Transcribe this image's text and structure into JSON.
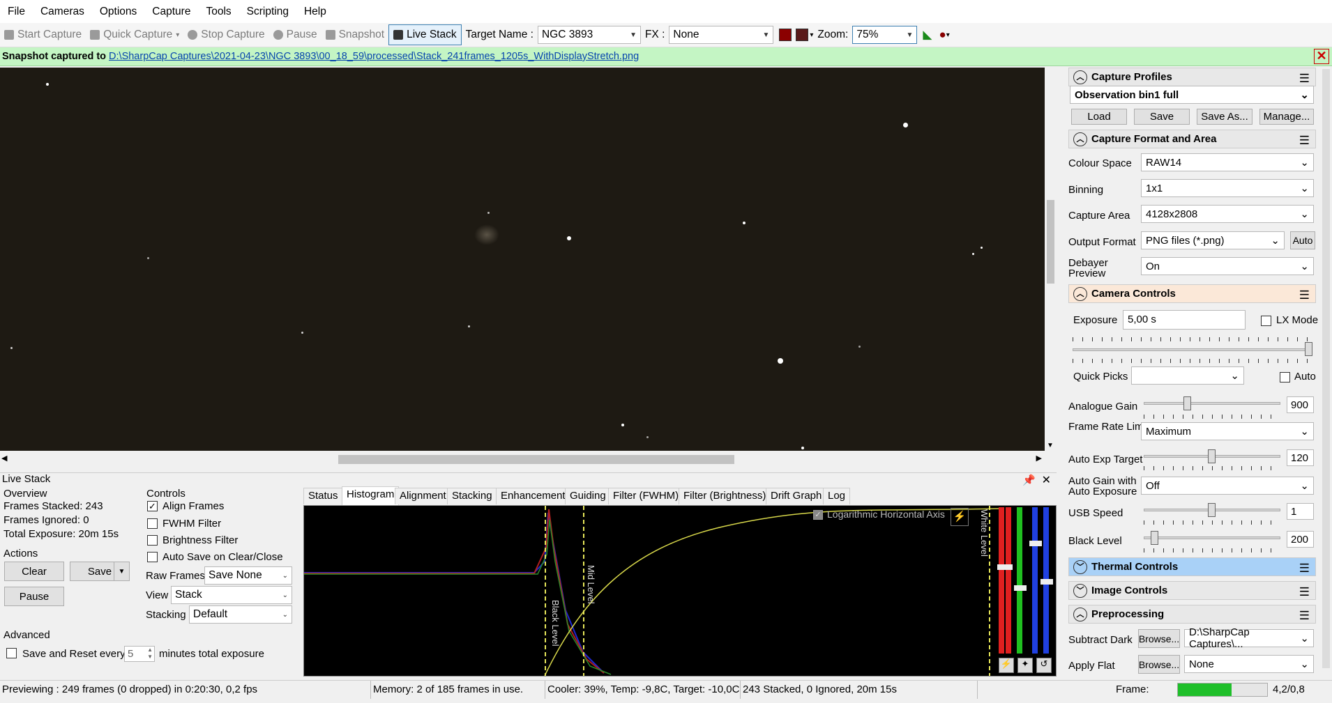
{
  "menu": [
    "File",
    "Cameras",
    "Options",
    "Capture",
    "Tools",
    "Scripting",
    "Help"
  ],
  "toolbar": {
    "start_capture": "Start Capture",
    "quick_capture": "Quick Capture",
    "stop_capture": "Stop Capture",
    "pause": "Pause",
    "snapshot": "Snapshot",
    "live_stack": "Live Stack",
    "target_label": "Target Name :",
    "target_value": "NGC 3893",
    "fx_label": "FX :",
    "fx_value": "None",
    "zoom_label": "Zoom:",
    "zoom_value": "75%"
  },
  "notify": {
    "prefix": "Snapshot captured to",
    "path": "D:\\SharpCap Captures\\2021-04-23\\NGC 3893\\00_18_59\\processed\\Stack_241frames_1205s_WithDisplayStretch.png"
  },
  "live_stack": {
    "title": "Live Stack",
    "overview_title": "Overview",
    "frames_stacked": "Frames Stacked: 243",
    "frames_ignored": "Frames Ignored:   0",
    "total_exposure": "Total Exposure:   20m 15s",
    "actions_title": "Actions",
    "clear": "Clear",
    "save": "Save",
    "pause": "Pause",
    "advanced_title": "Advanced",
    "save_reset": "Save and Reset every",
    "save_reset_value": "5",
    "save_reset_suffix": "minutes total exposure",
    "controls_title": "Controls",
    "align_frames": "Align Frames",
    "fwhm_filter": "FWHM Filter",
    "brightness_filter": "Brightness Filter",
    "auto_save": "Auto Save on Clear/Close",
    "raw_frames_label": "Raw Frames",
    "raw_frames_value": "Save None",
    "view_label": "View",
    "view_value": "Stack",
    "stacking_label": "Stacking",
    "stacking_value": "Default",
    "tabs": [
      "Status",
      "Histogram",
      "Alignment",
      "Stacking",
      "Enhancement",
      "Guiding",
      "Filter (FWHM)",
      "Filter (Brightness)",
      "Drift Graph",
      "Log"
    ],
    "histogram": {
      "log_axis": "Logarithmic Horizontal Axis",
      "black_level": "Black Level",
      "mid_level": "Mid Level",
      "white_level": "White Level"
    }
  },
  "right": {
    "capture_profiles": "Capture Profiles",
    "profile": "Observation bin1 full",
    "load": "Load",
    "save": "Save",
    "save_as": "Save As...",
    "manage": "Manage...",
    "capture_format": "Capture Format and Area",
    "colour_space_label": "Colour Space",
    "colour_space": "RAW14",
    "binning_label": "Binning",
    "binning": "1x1",
    "capture_area_label": "Capture Area",
    "capture_area": "4128x2808",
    "output_format_label": "Output Format",
    "output_format": "PNG files (*.png)",
    "auto": "Auto",
    "debayer_label": "Debayer Preview",
    "debayer": "On",
    "camera_controls": "Camera Controls",
    "exposure_label": "Exposure",
    "exposure": "5,00 s",
    "lx_mode": "LX Mode",
    "quick_picks_label": "Quick Picks",
    "auto2": "Auto",
    "analogue_gain_label": "Analogue Gain",
    "analogue_gain": "900",
    "frame_rate_label": "Frame Rate Limit",
    "frame_rate": "Maximum",
    "auto_exp_label": "Auto Exp Target",
    "auto_exp": "120",
    "auto_gain_label": "Auto Gain with Auto Exposure",
    "auto_gain": "Off",
    "usb_label": "USB Speed",
    "usb": "1",
    "black_level_label": "Black Level",
    "black_level": "200",
    "thermal": "Thermal Controls",
    "image_controls": "Image Controls",
    "preprocessing": "Preprocessing",
    "subtract_dark_label": "Subtract Dark",
    "browse": "Browse...",
    "subtract_dark": "D:\\SharpCap Captures\\...",
    "apply_flat_label": "Apply Flat",
    "apply_flat": "None"
  },
  "levels": {
    "analogue_gain": 0.32,
    "auto_exp": 0.5,
    "usb": 0.5,
    "black_level": 0.08
  },
  "status": {
    "previewing": "Previewing : 249 frames (0 dropped) in 0:20:30, 0,2 fps",
    "memory": "Memory: 2 of 185 frames in use.",
    "cooler": "Cooler: 39%, Temp: -9,8C, Target: -10,0C",
    "stacked": "243 Stacked, 0 Ignored, 20m 15s",
    "frame_label": "Frame:",
    "frame_value": "4,2/0,8"
  },
  "colors": {
    "notify_bg": "#c4f5c4",
    "camera_controls_header": "#fbe8d8",
    "thermal_header": "#a9d1f7",
    "frame_bar": "#1fbf2a"
  }
}
